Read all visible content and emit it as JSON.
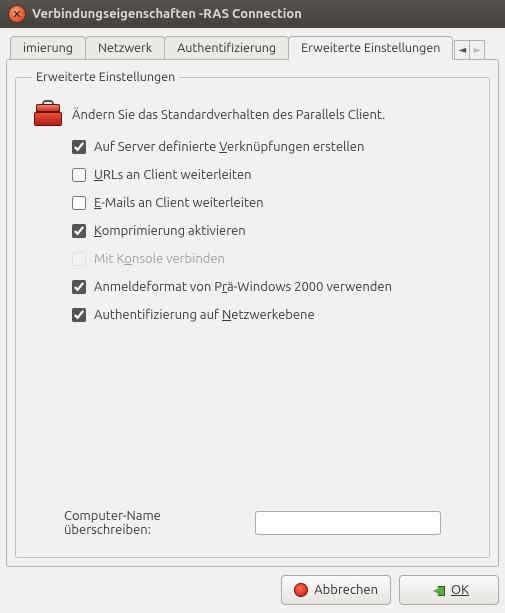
{
  "window": {
    "title": "Verbindungseigenschaften -RAS Connection"
  },
  "tabs": {
    "items": [
      {
        "label": "imierung"
      },
      {
        "label": "Netzwerk"
      },
      {
        "label": "Authentifizierung"
      },
      {
        "label": "Erweiterte Einstellungen"
      }
    ],
    "active_index": 3
  },
  "group": {
    "title": "Erweiterte Einstellungen",
    "intro": "Ändern Sie das Standardverhalten des Parallels Client."
  },
  "checks": [
    {
      "key": "shortcuts",
      "label_pre": "Auf Server definierte ",
      "accel": "V",
      "label_post": "erknüpfungen erstellen",
      "checked": true,
      "disabled": false
    },
    {
      "key": "urls",
      "label_pre": "",
      "accel": "U",
      "label_post": "RLs an Client weiterleiten",
      "checked": false,
      "disabled": false
    },
    {
      "key": "emails",
      "label_pre": "",
      "accel": "E",
      "label_post": "-Mails an Client weiterleiten",
      "checked": false,
      "disabled": false
    },
    {
      "key": "compress",
      "label_pre": "",
      "accel": "K",
      "label_post": "omprimierung aktivieren",
      "checked": true,
      "disabled": false
    },
    {
      "key": "console",
      "label_pre": "Mit K",
      "accel": "o",
      "label_post": "nsole verbinden",
      "checked": false,
      "disabled": true
    },
    {
      "key": "prewin",
      "label_pre": "Anmeldeformat von P",
      "accel": "r",
      "label_post": "ä-Windows 2000 verwenden",
      "checked": true,
      "disabled": false
    },
    {
      "key": "nla",
      "label_pre": "Authentifizierung auf ",
      "accel": "N",
      "label_post": "etzwerkebene",
      "checked": true,
      "disabled": false
    }
  ],
  "computer_name": {
    "label": "Computer-Name überschreiben:",
    "value": "",
    "placeholder": ""
  },
  "buttons": {
    "cancel": "Abbrechen",
    "ok": "OK"
  }
}
